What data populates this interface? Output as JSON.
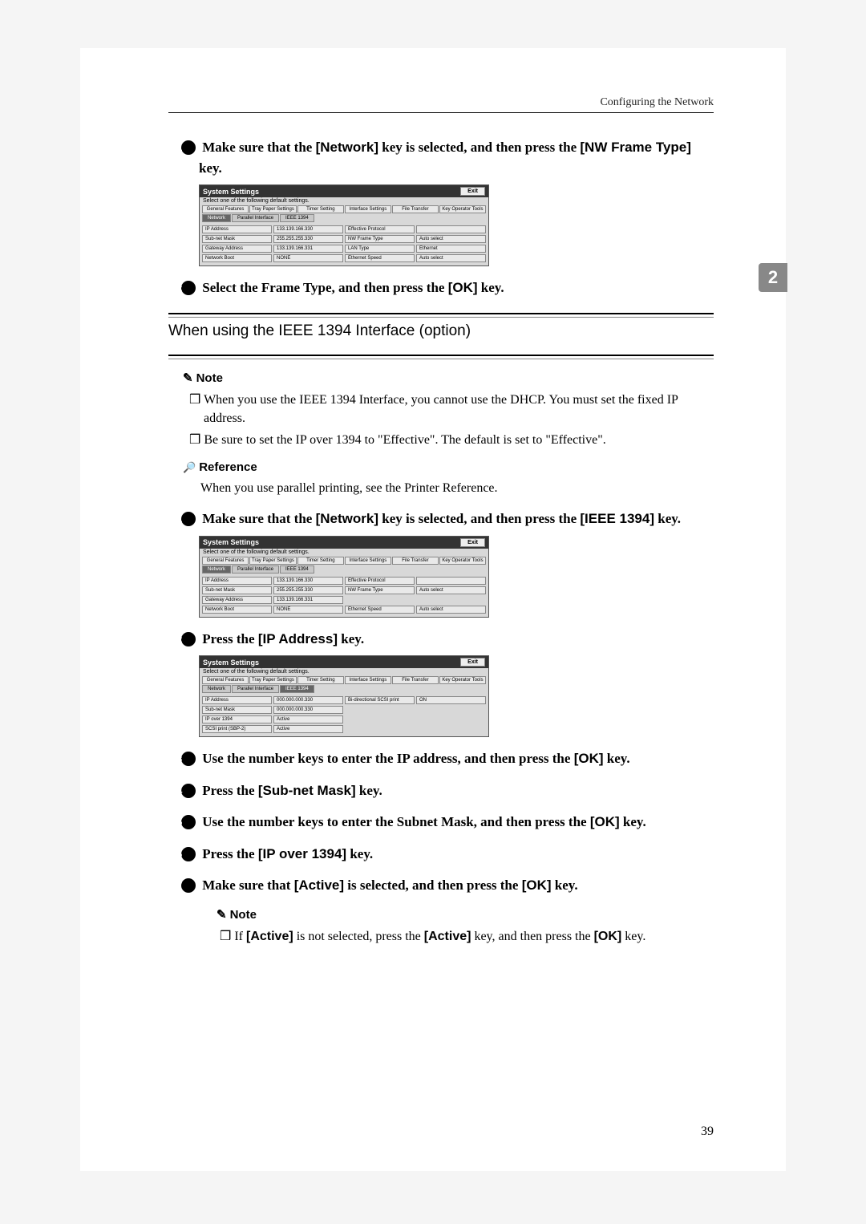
{
  "header": {
    "right": "Configuring the Network"
  },
  "side_tab": "2",
  "steps_a": {
    "s1": "Make sure that the ",
    "s1_ui": "[Network]",
    "s1_mid": " key is selected, and then press the ",
    "s1_ui2": "[NW Frame Type]",
    "s1_end": " key.",
    "s2": "Select the Frame Type, and then press the ",
    "s2_ui": "[OK]",
    "s2_end": " key."
  },
  "section": {
    "title": "When using the IEEE 1394 Interface (option)"
  },
  "note_label": "Note",
  "notes": [
    "When you use the IEEE 1394 Interface, you cannot use the DHCP. You must set the fixed IP address.",
    "Be sure to set the IP over 1394 to \"Effective\". The default is set to \"Effective\"."
  ],
  "ref_label": "Reference",
  "ref_body": "When you use parallel printing, see the Printer Reference.",
  "steps_b": {
    "s1": "Make sure that the ",
    "s1_ui": "[Network]",
    "s1_mid": " key is selected, and then press the ",
    "s1_ui2": "[IEEE 1394]",
    "s1_end": " key.",
    "s2": "Press the ",
    "s2_ui": "[IP Address]",
    "s2_end": " key.",
    "s3": "Use the number keys to enter the IP address, and then press the ",
    "s3_ui": "[OK]",
    "s3_end": " key.",
    "s4": "Press the ",
    "s4_ui": "[Sub-net Mask]",
    "s4_end": " key.",
    "s5": "Use the number keys to enter the Subnet Mask, and then press the ",
    "s5_ui": "[OK]",
    "s5_end": " key.",
    "s6": "Press the ",
    "s6_ui": "[IP over 1394]",
    "s6_end": " key.",
    "s7": "Make sure that ",
    "s7_ui": "[Active]",
    "s7_mid": " is selected, and then press the ",
    "s7_ui2": "[OK]",
    "s7_end": " key."
  },
  "sub_note_label": "Note",
  "sub_note": {
    "pre": "If ",
    "ui1": "[Active]",
    "mid1": " is not selected, press the ",
    "ui2": "[Active]",
    "mid2": " key, and then press the ",
    "ui3": "[OK]",
    "end": " key."
  },
  "page_number": "39",
  "screenshots": {
    "title": "System Settings",
    "exit": "Exit",
    "select_text": "Select one of the following default settings.",
    "tabs": [
      "General Features",
      "Tray Paper Settings",
      "Timer Setting",
      "Interface Settings",
      "File Transfer",
      "Key Operator Tools"
    ],
    "subtabs": [
      "Network",
      "Parallel Interface",
      "IEEE 1394"
    ],
    "s1": {
      "rows": [
        [
          "IP Address",
          "133.139.166.330",
          "Effective Protocol",
          ""
        ],
        [
          "Sub-net Mask",
          "255.255.255.330",
          "NW Frame Type",
          "Auto select"
        ],
        [
          "Gateway Address",
          "133.139.166.331",
          "LAN Type",
          "Ethernet"
        ],
        [
          "Network Boot",
          "NONE",
          "Ethernet Speed",
          "Auto select"
        ]
      ]
    },
    "s2": {
      "rows": [
        [
          "IP Address",
          "133.139.166.330",
          "Effective Protocol",
          ""
        ],
        [
          "Sub-net Mask",
          "255.255.255.330",
          "NW Frame Type",
          "Auto select"
        ],
        [
          "Gateway Address",
          "133.139.166.331",
          "",
          ""
        ],
        [
          "Network Boot",
          "NONE",
          "Ethernet Speed",
          "Auto select"
        ]
      ]
    },
    "s3": {
      "rows": [
        [
          "IP Address",
          "000.000.000.330",
          "Bi-directional SCSI print",
          "ON"
        ],
        [
          "Sub-net Mask",
          "000.000.000.330",
          "",
          ""
        ],
        [
          "IP over 1394",
          "Active",
          "",
          ""
        ],
        [
          "SCSI print (SBP-2)",
          "Active",
          "",
          ""
        ]
      ]
    }
  }
}
